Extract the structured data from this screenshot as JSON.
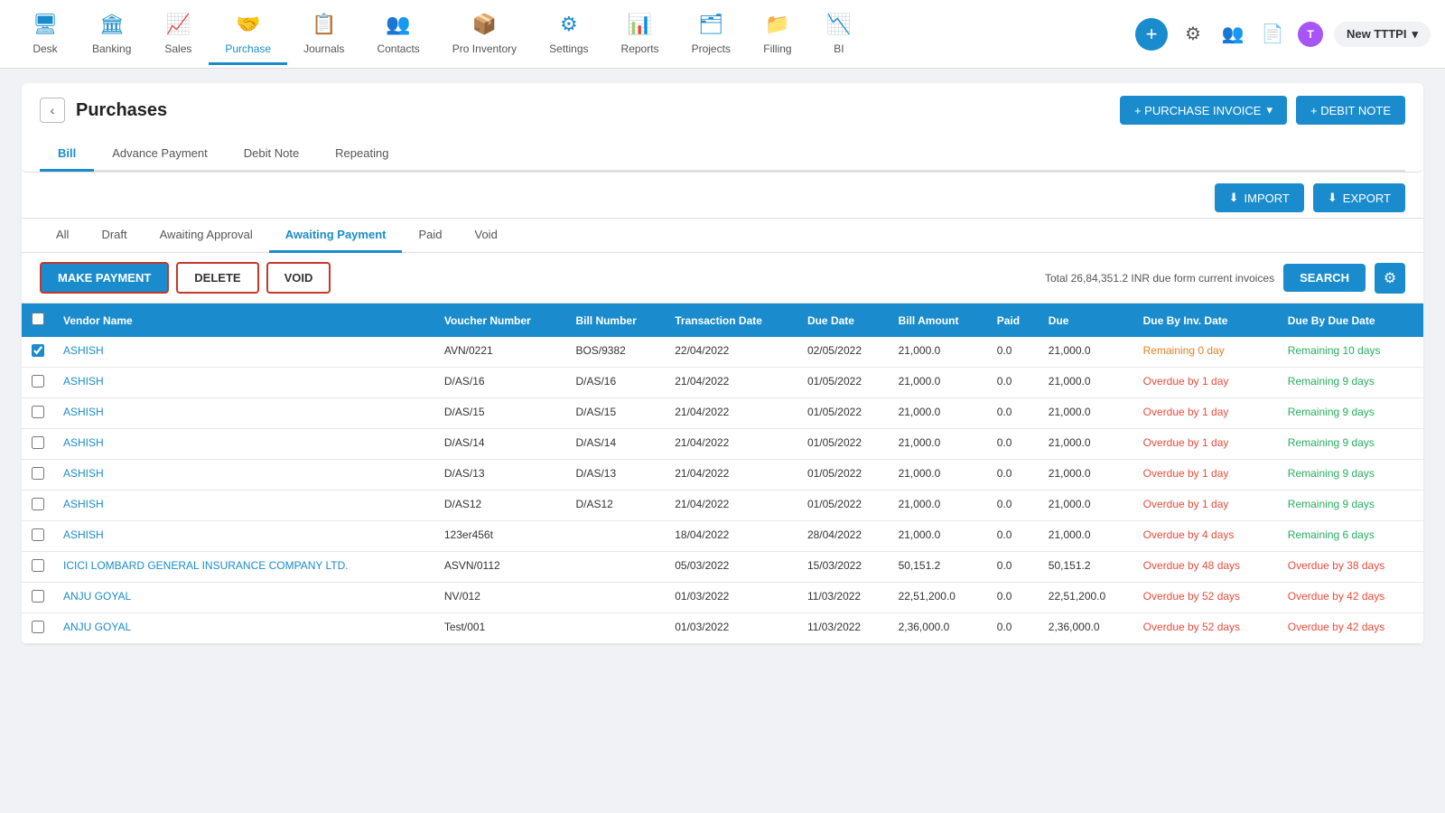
{
  "topNav": {
    "items": [
      {
        "id": "desk",
        "label": "Desk",
        "icon": "🖥"
      },
      {
        "id": "banking",
        "label": "Banking",
        "icon": "🏛"
      },
      {
        "id": "sales",
        "label": "Sales",
        "icon": "📈"
      },
      {
        "id": "purchase",
        "label": "Purchase",
        "icon": "🤝",
        "active": true
      },
      {
        "id": "journals",
        "label": "Journals",
        "icon": "📋"
      },
      {
        "id": "contacts",
        "label": "Contacts",
        "icon": "👥"
      },
      {
        "id": "pro-inventory",
        "label": "Pro Inventory",
        "icon": "📦"
      },
      {
        "id": "settings",
        "label": "Settings",
        "icon": "⚙"
      },
      {
        "id": "reports",
        "label": "Reports",
        "icon": "📊"
      },
      {
        "id": "projects",
        "label": "Projects",
        "icon": "🗂"
      },
      {
        "id": "filling",
        "label": "Filling",
        "icon": "📁"
      },
      {
        "id": "bi",
        "label": "BI",
        "icon": "📉"
      }
    ],
    "newLabel": "New TTTPI",
    "avatarText": "T"
  },
  "page": {
    "title": "Purchases",
    "backBtn": "‹",
    "tabs": [
      {
        "id": "bill",
        "label": "Bill",
        "active": true
      },
      {
        "id": "advance-payment",
        "label": "Advance Payment"
      },
      {
        "id": "debit-note",
        "label": "Debit Note"
      },
      {
        "id": "repeating",
        "label": "Repeating"
      }
    ],
    "purchaseInvoiceBtn": "+ PURCHASE INVOICE",
    "debitNoteBtn": "+ DEBIT NOTE",
    "importBtn": "IMPORT",
    "exportBtn": "EXPORT"
  },
  "filterTabs": [
    {
      "id": "all",
      "label": "All"
    },
    {
      "id": "draft",
      "label": "Draft"
    },
    {
      "id": "awaiting-approval",
      "label": "Awaiting Approval"
    },
    {
      "id": "awaiting-payment",
      "label": "Awaiting Payment",
      "active": true
    },
    {
      "id": "paid",
      "label": "Paid"
    },
    {
      "id": "void",
      "label": "Void"
    }
  ],
  "actionBar": {
    "makePaymentLabel": "MAKE PAYMENT",
    "deleteLabel": "DELETE",
    "voidLabel": "VOID",
    "totalText": "Total 26,84,351.2 INR due form current invoices",
    "searchLabel": "SEARCH"
  },
  "tableHeaders": [
    "Vendor Name",
    "Voucher Number",
    "Bill Number",
    "Transaction Date",
    "Due Date",
    "Bill Amount",
    "Paid",
    "Due",
    "Due By Inv. Date",
    "Due By Due Date"
  ],
  "tableRows": [
    {
      "checked": true,
      "vendorName": "ASHISH",
      "voucherNumber": "AVN/0221",
      "billNumber": "BOS/9382",
      "transactionDate": "22/04/2022",
      "dueDate": "02/05/2022",
      "billAmount": "21,000.0",
      "paid": "0.0",
      "due": "21,000.0",
      "dueByInvDate": "Remaining 0 day",
      "dueByDueDate": "Remaining 10 days",
      "invDateClass": "remaining-orange",
      "dueDateClass": "remaining-green"
    },
    {
      "checked": false,
      "vendorName": "ASHISH",
      "voucherNumber": "D/AS/16",
      "billNumber": "D/AS/16",
      "transactionDate": "21/04/2022",
      "dueDate": "01/05/2022",
      "billAmount": "21,000.0",
      "paid": "0.0",
      "due": "21,000.0",
      "dueByInvDate": "Overdue by 1 day",
      "dueByDueDate": "Remaining 9 days",
      "invDateClass": "overdue-red",
      "dueDateClass": "remaining-green"
    },
    {
      "checked": false,
      "vendorName": "ASHISH",
      "voucherNumber": "D/AS/15",
      "billNumber": "D/AS/15",
      "transactionDate": "21/04/2022",
      "dueDate": "01/05/2022",
      "billAmount": "21,000.0",
      "paid": "0.0",
      "due": "21,000.0",
      "dueByInvDate": "Overdue by 1 day",
      "dueByDueDate": "Remaining 9 days",
      "invDateClass": "overdue-red",
      "dueDateClass": "remaining-green"
    },
    {
      "checked": false,
      "vendorName": "ASHISH",
      "voucherNumber": "D/AS/14",
      "billNumber": "D/AS/14",
      "transactionDate": "21/04/2022",
      "dueDate": "01/05/2022",
      "billAmount": "21,000.0",
      "paid": "0.0",
      "due": "21,000.0",
      "dueByInvDate": "Overdue by 1 day",
      "dueByDueDate": "Remaining 9 days",
      "invDateClass": "overdue-red",
      "dueDateClass": "remaining-green"
    },
    {
      "checked": false,
      "vendorName": "ASHISH",
      "voucherNumber": "D/AS/13",
      "billNumber": "D/AS/13",
      "transactionDate": "21/04/2022",
      "dueDate": "01/05/2022",
      "billAmount": "21,000.0",
      "paid": "0.0",
      "due": "21,000.0",
      "dueByInvDate": "Overdue by 1 day",
      "dueByDueDate": "Remaining 9 days",
      "invDateClass": "overdue-red",
      "dueDateClass": "remaining-green"
    },
    {
      "checked": false,
      "vendorName": "ASHISH",
      "voucherNumber": "D/AS12",
      "billNumber": "D/AS12",
      "transactionDate": "21/04/2022",
      "dueDate": "01/05/2022",
      "billAmount": "21,000.0",
      "paid": "0.0",
      "due": "21,000.0",
      "dueByInvDate": "Overdue by 1 day",
      "dueByDueDate": "Remaining 9 days",
      "invDateClass": "overdue-red",
      "dueDateClass": "remaining-green"
    },
    {
      "checked": false,
      "vendorName": "ASHISH",
      "voucherNumber": "123er456t",
      "billNumber": "",
      "transactionDate": "18/04/2022",
      "dueDate": "28/04/2022",
      "billAmount": "21,000.0",
      "paid": "0.0",
      "due": "21,000.0",
      "dueByInvDate": "Overdue by 4 days",
      "dueByDueDate": "Remaining 6 days",
      "invDateClass": "overdue-red",
      "dueDateClass": "remaining-green"
    },
    {
      "checked": false,
      "vendorName": "ICICI LOMBARD GENERAL INSURANCE COMPANY LTD.",
      "voucherNumber": "ASVN/0112",
      "billNumber": "",
      "transactionDate": "05/03/2022",
      "dueDate": "15/03/2022",
      "billAmount": "50,151.2",
      "paid": "0.0",
      "due": "50,151.2",
      "dueByInvDate": "Overdue by 48 days",
      "dueByDueDate": "Overdue by 38 days",
      "invDateClass": "overdue-red",
      "dueDateClass": "overdue-red"
    },
    {
      "checked": false,
      "vendorName": "ANJU GOYAL",
      "voucherNumber": "NV/012",
      "billNumber": "",
      "transactionDate": "01/03/2022",
      "dueDate": "11/03/2022",
      "billAmount": "22,51,200.0",
      "paid": "0.0",
      "due": "22,51,200.0",
      "dueByInvDate": "Overdue by 52 days",
      "dueByDueDate": "Overdue by 42 days",
      "invDateClass": "overdue-red",
      "dueDateClass": "overdue-red"
    },
    {
      "checked": false,
      "vendorName": "ANJU GOYAL",
      "voucherNumber": "Test/001",
      "billNumber": "",
      "transactionDate": "01/03/2022",
      "dueDate": "11/03/2022",
      "billAmount": "2,36,000.0",
      "paid": "0.0",
      "due": "2,36,000.0",
      "dueByInvDate": "Overdue by 52 days",
      "dueByDueDate": "Overdue by 42 days",
      "invDateClass": "overdue-red",
      "dueDateClass": "overdue-red"
    }
  ]
}
